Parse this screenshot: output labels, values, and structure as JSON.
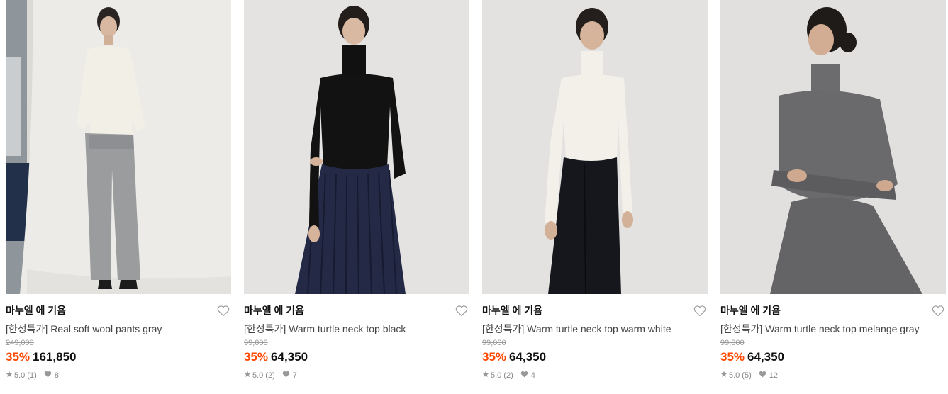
{
  "products": [
    {
      "brand": "마누엘 에 기욤",
      "title": "[한정특가] Real soft wool pants gray",
      "original_price": "249,000",
      "discount": "35%",
      "price": "161,850",
      "rating": "5.0",
      "reviews": "(1)",
      "likes": "8",
      "image": "model in white top and gray wide wool pants"
    },
    {
      "brand": "마누엘 에 기욤",
      "title": "[한정특가] Warm turtle neck top black",
      "original_price": "99,000",
      "discount": "35%",
      "price": "64,350",
      "rating": "5.0",
      "reviews": "(2)",
      "likes": "7",
      "image": "model in black turtleneck and navy pleated skirt"
    },
    {
      "brand": "마누엘 에 기욤",
      "title": "[한정특가] Warm turtle neck top warm white",
      "original_price": "99,000",
      "discount": "35%",
      "price": "64,350",
      "rating": "5.0",
      "reviews": "(2)",
      "likes": "4",
      "image": "model in white turtleneck and black pants"
    },
    {
      "brand": "마누엘 에 기욤",
      "title": "[한정특가] Warm turtle neck top melange gray",
      "original_price": "99,000",
      "discount": "35%",
      "price": "64,350",
      "rating": "5.0",
      "reviews": "(5)",
      "likes": "12",
      "image": "model in gray turtleneck and gray flared skirt"
    }
  ],
  "colors": {
    "discount": "#ff4800",
    "price": "#111111",
    "muted": "#999999"
  },
  "icons": {
    "wishlist": "heart-outline-icon",
    "rating": "star-icon",
    "likes": "heart-filled-icon"
  }
}
